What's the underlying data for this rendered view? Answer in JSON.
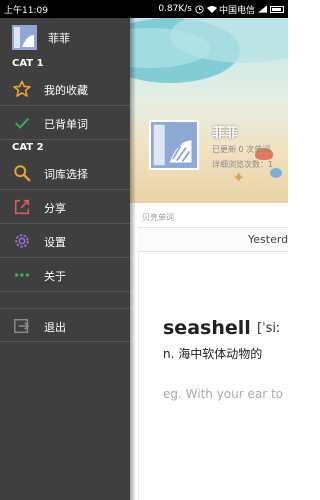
{
  "status_bar": {
    "time": "上午11:09",
    "speed": "0.87K/s",
    "carrier": "中国电信"
  },
  "drawer": {
    "user_name": "菲菲",
    "sections": [
      {
        "title": "CAT 1",
        "items": [
          {
            "label": "我的收藏",
            "icon": "star-icon"
          },
          {
            "label": "已背单词",
            "icon": "check-icon"
          }
        ]
      },
      {
        "title": "CAT 2",
        "items": [
          {
            "label": "词库选择",
            "icon": "search-icon"
          },
          {
            "label": "分享",
            "icon": "share-icon"
          },
          {
            "label": "设置",
            "icon": "gear-icon"
          },
          {
            "label": "关于",
            "icon": "more-dots-icon"
          }
        ]
      }
    ],
    "logout": {
      "label": "退出",
      "icon": "exit-icon"
    }
  },
  "main": {
    "profile": {
      "name": "菲菲",
      "updated": "已更新 0 次单词",
      "views": "详细浏览次数：1"
    },
    "section_label": "贝壳单词",
    "date_label": "Yesterd",
    "word": {
      "term": "seashell",
      "phonetic": "[ˈsiː",
      "meaning": "n. 海中软体动物的",
      "example": "eg. With your ear to"
    }
  },
  "colors": {
    "drawer_bg": "#3f3f3f",
    "star": "#e8a533",
    "check": "#33b55a",
    "search": "#e8a533",
    "share": "#e05858",
    "gear": "#8f6fd0",
    "dots": "#33b55a"
  }
}
